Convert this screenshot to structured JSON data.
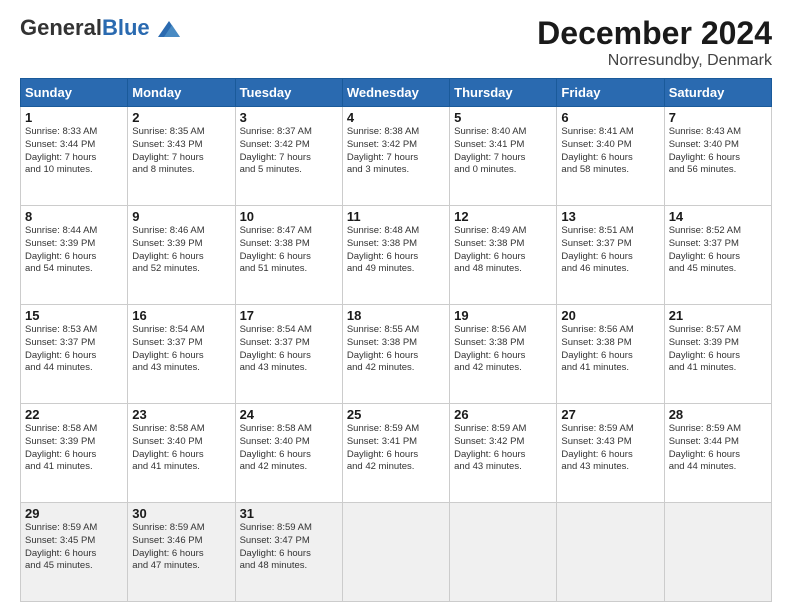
{
  "header": {
    "logo_general": "General",
    "logo_blue": "Blue",
    "main_title": "December 2024",
    "subtitle": "Norresundby, Denmark"
  },
  "columns": [
    "Sunday",
    "Monday",
    "Tuesday",
    "Wednesday",
    "Thursday",
    "Friday",
    "Saturday"
  ],
  "weeks": [
    [
      {
        "day": "1",
        "lines": [
          "Sunrise: 8:33 AM",
          "Sunset: 3:44 PM",
          "Daylight: 7 hours",
          "and 10 minutes."
        ]
      },
      {
        "day": "2",
        "lines": [
          "Sunrise: 8:35 AM",
          "Sunset: 3:43 PM",
          "Daylight: 7 hours",
          "and 8 minutes."
        ]
      },
      {
        "day": "3",
        "lines": [
          "Sunrise: 8:37 AM",
          "Sunset: 3:42 PM",
          "Daylight: 7 hours",
          "and 5 minutes."
        ]
      },
      {
        "day": "4",
        "lines": [
          "Sunrise: 8:38 AM",
          "Sunset: 3:42 PM",
          "Daylight: 7 hours",
          "and 3 minutes."
        ]
      },
      {
        "day": "5",
        "lines": [
          "Sunrise: 8:40 AM",
          "Sunset: 3:41 PM",
          "Daylight: 7 hours",
          "and 0 minutes."
        ]
      },
      {
        "day": "6",
        "lines": [
          "Sunrise: 8:41 AM",
          "Sunset: 3:40 PM",
          "Daylight: 6 hours",
          "and 58 minutes."
        ]
      },
      {
        "day": "7",
        "lines": [
          "Sunrise: 8:43 AM",
          "Sunset: 3:40 PM",
          "Daylight: 6 hours",
          "and 56 minutes."
        ]
      }
    ],
    [
      {
        "day": "8",
        "lines": [
          "Sunrise: 8:44 AM",
          "Sunset: 3:39 PM",
          "Daylight: 6 hours",
          "and 54 minutes."
        ]
      },
      {
        "day": "9",
        "lines": [
          "Sunrise: 8:46 AM",
          "Sunset: 3:39 PM",
          "Daylight: 6 hours",
          "and 52 minutes."
        ]
      },
      {
        "day": "10",
        "lines": [
          "Sunrise: 8:47 AM",
          "Sunset: 3:38 PM",
          "Daylight: 6 hours",
          "and 51 minutes."
        ]
      },
      {
        "day": "11",
        "lines": [
          "Sunrise: 8:48 AM",
          "Sunset: 3:38 PM",
          "Daylight: 6 hours",
          "and 49 minutes."
        ]
      },
      {
        "day": "12",
        "lines": [
          "Sunrise: 8:49 AM",
          "Sunset: 3:38 PM",
          "Daylight: 6 hours",
          "and 48 minutes."
        ]
      },
      {
        "day": "13",
        "lines": [
          "Sunrise: 8:51 AM",
          "Sunset: 3:37 PM",
          "Daylight: 6 hours",
          "and 46 minutes."
        ]
      },
      {
        "day": "14",
        "lines": [
          "Sunrise: 8:52 AM",
          "Sunset: 3:37 PM",
          "Daylight: 6 hours",
          "and 45 minutes."
        ]
      }
    ],
    [
      {
        "day": "15",
        "lines": [
          "Sunrise: 8:53 AM",
          "Sunset: 3:37 PM",
          "Daylight: 6 hours",
          "and 44 minutes."
        ]
      },
      {
        "day": "16",
        "lines": [
          "Sunrise: 8:54 AM",
          "Sunset: 3:37 PM",
          "Daylight: 6 hours",
          "and 43 minutes."
        ]
      },
      {
        "day": "17",
        "lines": [
          "Sunrise: 8:54 AM",
          "Sunset: 3:37 PM",
          "Daylight: 6 hours",
          "and 43 minutes."
        ]
      },
      {
        "day": "18",
        "lines": [
          "Sunrise: 8:55 AM",
          "Sunset: 3:38 PM",
          "Daylight: 6 hours",
          "and 42 minutes."
        ]
      },
      {
        "day": "19",
        "lines": [
          "Sunrise: 8:56 AM",
          "Sunset: 3:38 PM",
          "Daylight: 6 hours",
          "and 42 minutes."
        ]
      },
      {
        "day": "20",
        "lines": [
          "Sunrise: 8:56 AM",
          "Sunset: 3:38 PM",
          "Daylight: 6 hours",
          "and 41 minutes."
        ]
      },
      {
        "day": "21",
        "lines": [
          "Sunrise: 8:57 AM",
          "Sunset: 3:39 PM",
          "Daylight: 6 hours",
          "and 41 minutes."
        ]
      }
    ],
    [
      {
        "day": "22",
        "lines": [
          "Sunrise: 8:58 AM",
          "Sunset: 3:39 PM",
          "Daylight: 6 hours",
          "and 41 minutes."
        ]
      },
      {
        "day": "23",
        "lines": [
          "Sunrise: 8:58 AM",
          "Sunset: 3:40 PM",
          "Daylight: 6 hours",
          "and 41 minutes."
        ]
      },
      {
        "day": "24",
        "lines": [
          "Sunrise: 8:58 AM",
          "Sunset: 3:40 PM",
          "Daylight: 6 hours",
          "and 42 minutes."
        ]
      },
      {
        "day": "25",
        "lines": [
          "Sunrise: 8:59 AM",
          "Sunset: 3:41 PM",
          "Daylight: 6 hours",
          "and 42 minutes."
        ]
      },
      {
        "day": "26",
        "lines": [
          "Sunrise: 8:59 AM",
          "Sunset: 3:42 PM",
          "Daylight: 6 hours",
          "and 43 minutes."
        ]
      },
      {
        "day": "27",
        "lines": [
          "Sunrise: 8:59 AM",
          "Sunset: 3:43 PM",
          "Daylight: 6 hours",
          "and 43 minutes."
        ]
      },
      {
        "day": "28",
        "lines": [
          "Sunrise: 8:59 AM",
          "Sunset: 3:44 PM",
          "Daylight: 6 hours",
          "and 44 minutes."
        ]
      }
    ],
    [
      {
        "day": "29",
        "lines": [
          "Sunrise: 8:59 AM",
          "Sunset: 3:45 PM",
          "Daylight: 6 hours",
          "and 45 minutes."
        ]
      },
      {
        "day": "30",
        "lines": [
          "Sunrise: 8:59 AM",
          "Sunset: 3:46 PM",
          "Daylight: 6 hours",
          "and 47 minutes."
        ]
      },
      {
        "day": "31",
        "lines": [
          "Sunrise: 8:59 AM",
          "Sunset: 3:47 PM",
          "Daylight: 6 hours",
          "and 48 minutes."
        ]
      },
      null,
      null,
      null,
      null
    ]
  ]
}
